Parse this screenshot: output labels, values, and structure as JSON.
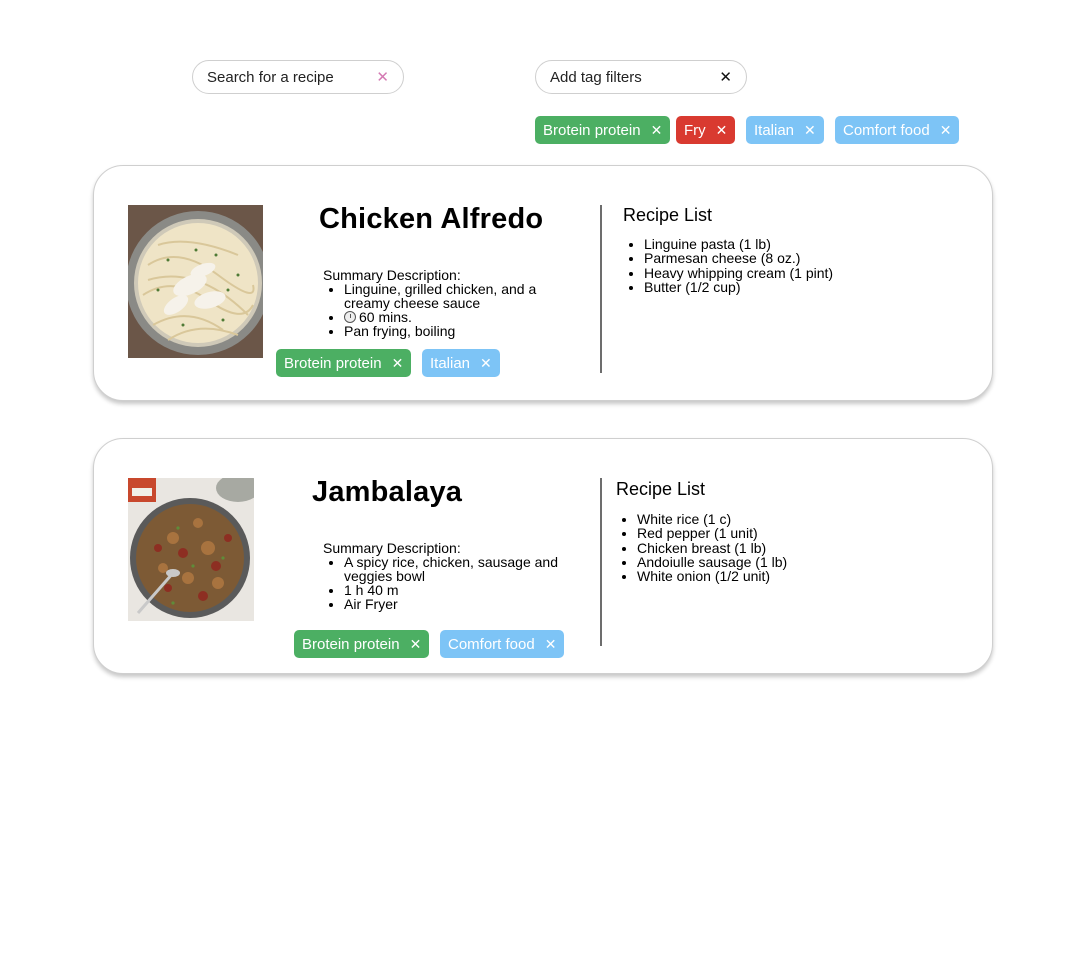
{
  "search": {
    "placeholder": "Search for a recipe",
    "clear_icon": "close-icon"
  },
  "tag_filter": {
    "placeholder": "Add tag filters",
    "clear_icon": "close-icon"
  },
  "colors": {
    "green": "#4caf63",
    "red": "#d93a30",
    "blue": "#7dc4f6",
    "search_clear": "#d47ab3"
  },
  "active_filters": [
    {
      "label": "Brotein protein",
      "color": "green"
    },
    {
      "label": "Fry",
      "color": "red"
    },
    {
      "label": "Italian",
      "color": "blue"
    },
    {
      "label": "Comfort food",
      "color": "blue"
    }
  ],
  "recipes": [
    {
      "title": "Chicken Alfredo",
      "summary_label": "Summary Description:",
      "summary_items": [
        "Linguine, grilled chicken, and a creamy cheese sauce",
        "60 mins.",
        "Pan frying, boiling"
      ],
      "time_icon": "clock-icon",
      "tags": [
        {
          "label": "Brotein protein",
          "color": "green"
        },
        {
          "label": "Italian",
          "color": "blue"
        }
      ],
      "recipe_list_title": "Recipe List",
      "ingredients": [
        "Linguine pasta (1 lb)",
        "Parmesan cheese (8 oz.)",
        "Heavy whipping cream (1 pint)",
        "Butter (1/2 cup)"
      ]
    },
    {
      "title": "Jambalaya",
      "summary_label": "Summary Description:",
      "summary_items": [
        "A spicy rice, chicken, sausage and veggies bowl",
        "1 h 40 m",
        "Air Fryer"
      ],
      "tags": [
        {
          "label": "Brotein protein",
          "color": "green"
        },
        {
          "label": "Comfort food",
          "color": "blue"
        }
      ],
      "recipe_list_title": "Recipe List",
      "ingredients": [
        "White rice (1 c)",
        "Red pepper (1 unit)",
        "Chicken breast (1 lb)",
        "Andoiulle sausage (1 lb)",
        "White onion (1/2 unit)"
      ]
    }
  ]
}
